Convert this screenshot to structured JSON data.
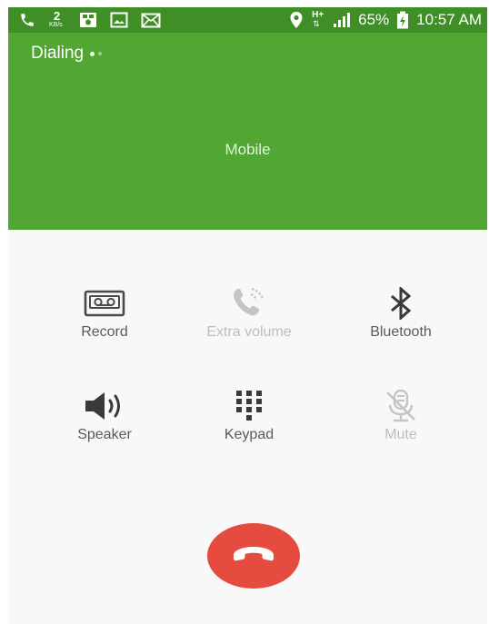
{
  "status_bar": {
    "data_rate_value": "2",
    "data_rate_unit": "KB/s",
    "network_type": "H+",
    "battery_percent": "65%",
    "time": "10:57 AM"
  },
  "call": {
    "status": "Dialing",
    "label": "Mobile"
  },
  "controls": [
    {
      "label": "Record",
      "icon": "cassette-icon",
      "enabled": true
    },
    {
      "label": "Extra volume",
      "icon": "extra-volume-icon",
      "enabled": false
    },
    {
      "label": "Bluetooth",
      "icon": "bluetooth-icon",
      "enabled": true
    },
    {
      "label": "Speaker",
      "icon": "speaker-icon",
      "enabled": true
    },
    {
      "label": "Keypad",
      "icon": "keypad-icon",
      "enabled": true
    },
    {
      "label": "Mute",
      "icon": "mute-icon",
      "enabled": false
    }
  ],
  "colors": {
    "status_bar": "#3f8f26",
    "header": "#52a734",
    "end_call": "#e54c3f",
    "icon_active": "#4a4a4a",
    "icon_disabled": "#c4c4c4"
  }
}
